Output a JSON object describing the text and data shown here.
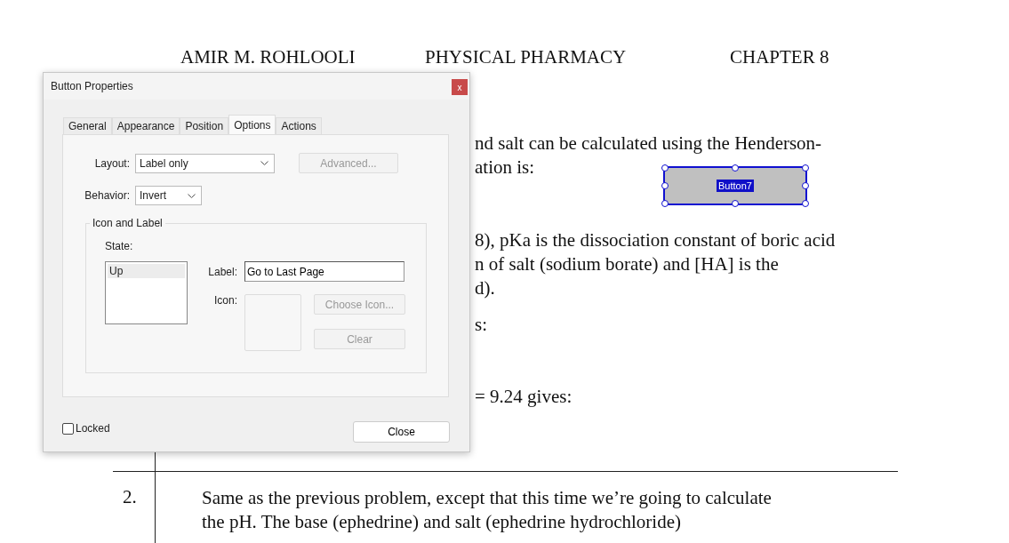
{
  "document": {
    "header": [
      "AMIR M. ROHLOOLI",
      "PHYSICAL PHARMACY",
      "CHAPTER 8"
    ],
    "lines": [
      "nd salt can be calculated using the Henderson-",
      "ation is:",
      "8), pKa is the dissociation constant of boric acid",
      "n of salt (sodium borate) and [HA] is the",
      "d).",
      "s:",
      "= 9.24 gives:"
    ],
    "form_button": {
      "label": "Button7",
      "selected": true
    },
    "table_row": {
      "number": "2.",
      "lines": [
        "Same as the previous problem, except that this time we’re going to calculate",
        "the pH. The base (ephedrine) and salt (ephedrine hydrochloride)"
      ]
    }
  },
  "dialog": {
    "title": "Button Properties",
    "close": "x",
    "tabs": [
      {
        "label": "General",
        "selected": false
      },
      {
        "label": "Appearance",
        "selected": false
      },
      {
        "label": "Position",
        "selected": false
      },
      {
        "label": "Options",
        "selected": true
      },
      {
        "label": "Actions",
        "selected": false
      }
    ],
    "layout": {
      "label": "Layout:",
      "value": "Label only"
    },
    "advanced": {
      "label": "Advanced...",
      "disabled": true
    },
    "behavior": {
      "label": "Behavior:",
      "value": "Invert"
    },
    "group": {
      "title": "Icon and Label",
      "state_label": "State:",
      "states": [
        {
          "label": "Up",
          "selected": true
        }
      ],
      "label_field": {
        "label": "Label:",
        "value": "Go to Last Page"
      },
      "icon_label": "Icon:",
      "choose_icon": {
        "label": "Choose Icon...",
        "disabled": true
      },
      "clear": {
        "label": "Clear",
        "disabled": true
      }
    },
    "locked": {
      "label": "Locked",
      "checked": false
    },
    "close_button": "Close"
  }
}
